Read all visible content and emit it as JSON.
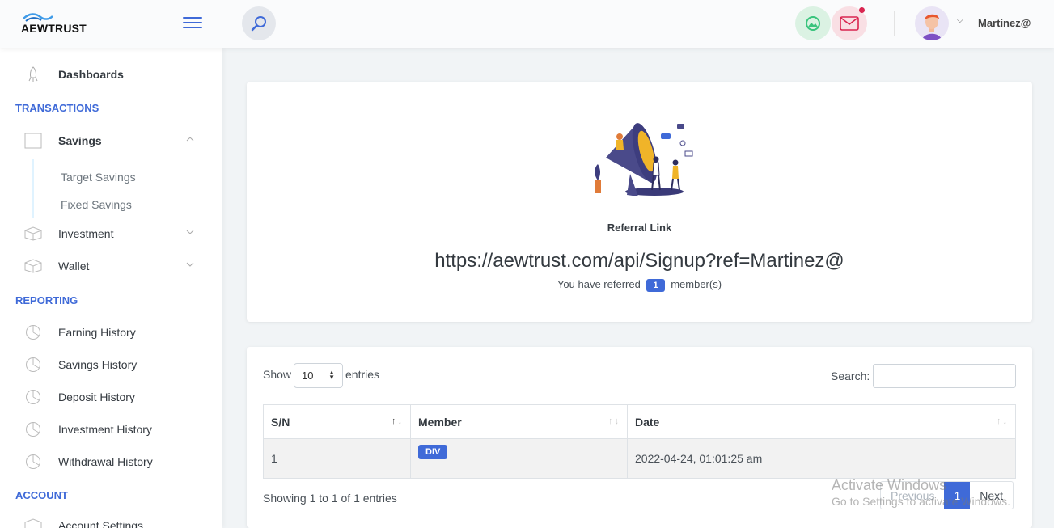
{
  "brand": {
    "name": "AEWTRUST"
  },
  "header": {
    "username": "Martinez@"
  },
  "sidebar": {
    "dashboards": "Dashboards",
    "section_transactions": "TRANSACTIONS",
    "savings": "Savings",
    "savings_sub": [
      "Target Savings",
      "Fixed Savings"
    ],
    "investment": "Investment",
    "wallet": "Wallet",
    "section_reporting": "REPORTING",
    "reports": [
      "Earning History",
      "Savings History",
      "Deposit History",
      "Investment History",
      "Withdrawal History"
    ],
    "section_account": "ACCOUNT",
    "account_settings": "Account Settings"
  },
  "referral": {
    "title": "Referral Link",
    "link": "https://aewtrust.com/api/Signup?ref=Martinez@",
    "prefix": "You have referred",
    "count": "1",
    "suffix": "member(s)"
  },
  "table": {
    "show_label": "Show",
    "entries_value": "10",
    "entries_label": "entries",
    "search_label": "Search:",
    "columns": [
      "S/N",
      "Member",
      "Date"
    ],
    "rows": [
      {
        "sn": "1",
        "member": "DIV",
        "date": "2022-04-24, 01:01:25 am"
      }
    ],
    "info": "Showing 1 to 1 of 1 entries",
    "pagination": {
      "previous": "Previous",
      "current": "1",
      "next": "Next"
    }
  },
  "watermark": {
    "line1": "Activate Windows",
    "line2": "Go to Settings to activate Windows."
  },
  "colors": {
    "accent": "#3f6ad8",
    "success_bg": "#dbf2e3",
    "danger_bg": "#f9dfe4",
    "danger": "#d92550"
  }
}
